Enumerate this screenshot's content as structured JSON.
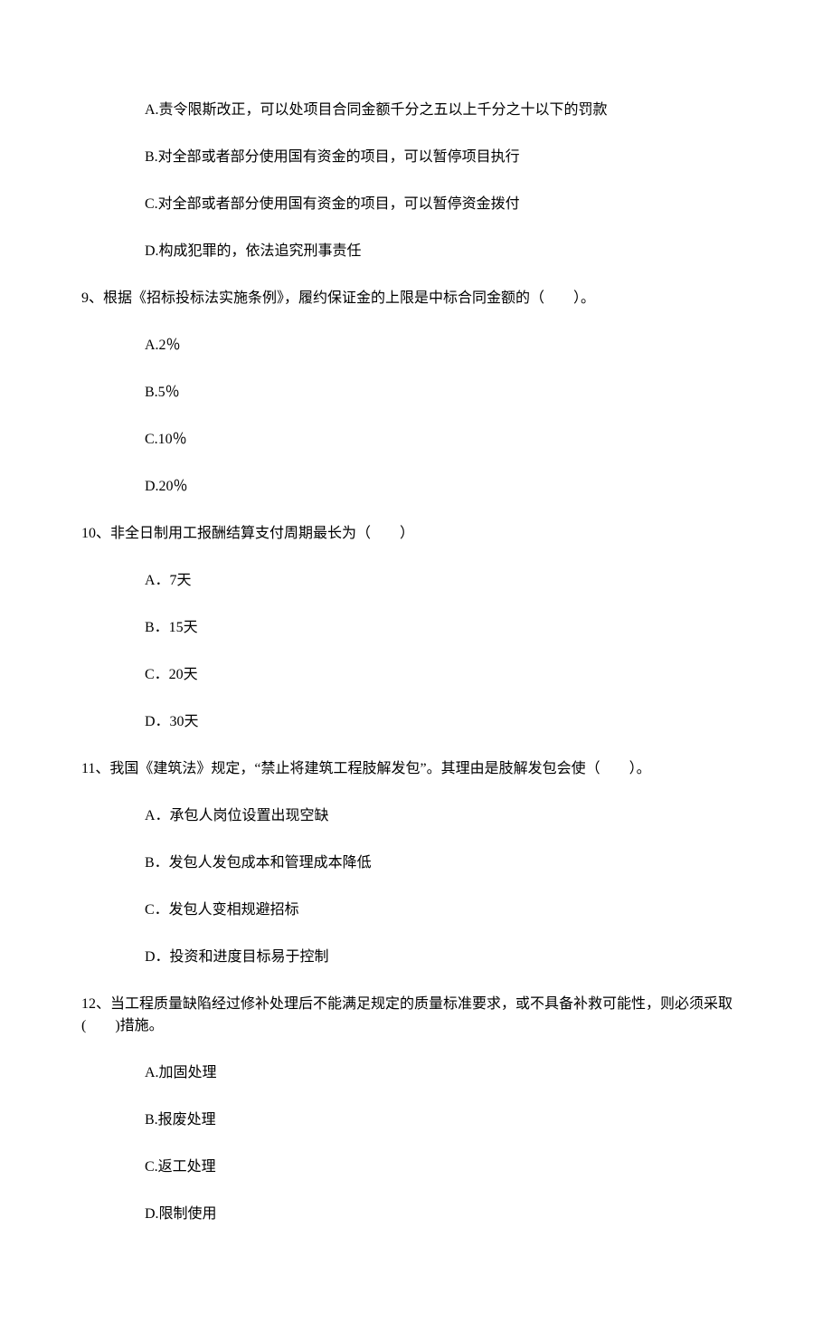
{
  "options_pre": [
    "A.责令限斯改正，可以处项目合同金额千分之五以上千分之十以下的罚款",
    "B.对全部或者部分使用国有资金的项目，可以暂停项目执行",
    "C.对全部或者部分使用国有资金的项目，可以暂停资金拨付",
    "D.构成犯罪的，依法追究刑事责任"
  ],
  "q9": {
    "text": "9、根据《招标投标法实施条例》，履约保证金的上限是中标合同金额的（　　）。",
    "opts": [
      "A.2％",
      "B.5％",
      "C.10％",
      "D.20％"
    ]
  },
  "q10": {
    "text": "10、非全日制用工报酬结算支付周期最长为（　　）",
    "opts": [
      "A．7天",
      "B．15天",
      "C．20天",
      "D．30天"
    ]
  },
  "q11": {
    "text": "11、我国《建筑法》规定，“禁止将建筑工程肢解发包”。其理由是肢解发包会使（　　）。",
    "opts": [
      "A．承包人岗位设置出现空缺",
      "B．发包人发包成本和管理成本降低",
      "C．发包人变相规避招标",
      "D．投资和进度目标易于控制"
    ]
  },
  "q12": {
    "text": "12、当工程质量缺陷经过修补处理后不能满足规定的质量标准要求，或不具备补救可能性，则必须采取(　　)措施。",
    "opts": [
      "A.加固处理",
      "B.报废处理",
      "C.返工处理",
      "D.限制使用"
    ]
  }
}
